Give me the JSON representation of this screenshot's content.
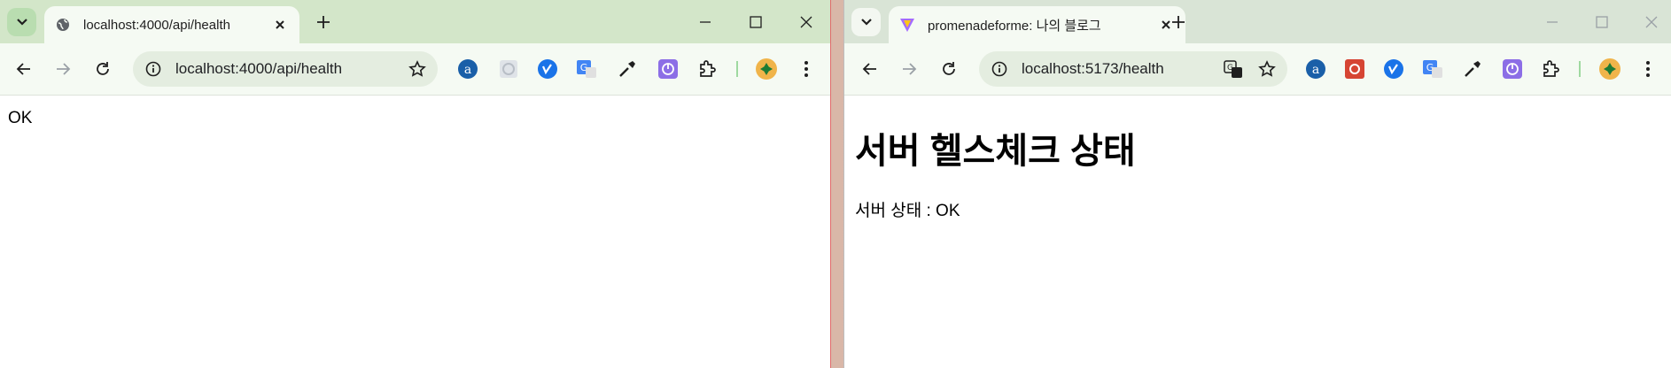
{
  "left_window": {
    "tab_title": "localhost:4000/api/health",
    "url": "localhost:4000/api/health",
    "content_text": "OK"
  },
  "right_window": {
    "tab_title": "promenadeforme: 나의 블로그",
    "url": "localhost:5173/health",
    "heading": "서버 헬스체크 상태",
    "status_text": "서버 상태 : OK"
  },
  "extension_icons": [
    "font-extension-icon",
    "grid-extension-icon",
    "vimeo-extension-icon",
    "translate-extension-icon",
    "eyedropper-extension-icon",
    "power-extension-icon",
    "puzzle-extensions-icon",
    "profile-avatar"
  ],
  "colors": {
    "left_tabbar": "#d3e6c9",
    "right_tabbar": "#d9e4d6",
    "accent_blue": "#1a73e8",
    "purple_ext": "#8c6ee6"
  }
}
